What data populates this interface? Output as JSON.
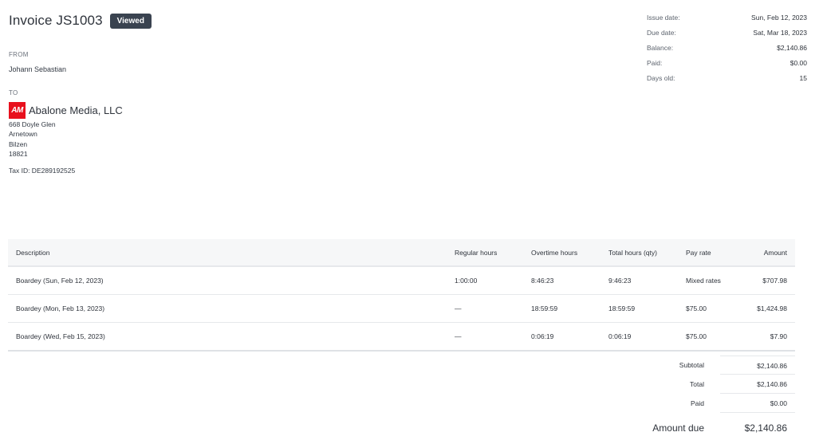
{
  "invoice": {
    "title": "Invoice JS1003",
    "status": "Viewed"
  },
  "from": {
    "label": "FROM",
    "name": "Johann Sebastian"
  },
  "to": {
    "label": "TO",
    "logo_text": "AM",
    "company": "Abalone Media, LLC",
    "address": [
      "668 Doyle Glen",
      "Arnetown",
      "Bilzen",
      "18821"
    ],
    "tax_id": "Tax ID: DE289192525"
  },
  "meta": [
    {
      "key": "Issue date:",
      "value": "Sun, Feb 12, 2023"
    },
    {
      "key": "Due date:",
      "value": "Sat, Mar 18, 2023"
    },
    {
      "key": "Balance:",
      "value": "$2,140.86"
    },
    {
      "key": "Paid:",
      "value": "$0.00"
    },
    {
      "key": "Days old:",
      "value": "15"
    }
  ],
  "table": {
    "headers": [
      "Description",
      "Regular hours",
      "Overtime hours",
      "Total hours (qty)",
      "Pay rate",
      "Amount"
    ],
    "rows": [
      [
        "Boardey (Sun, Feb 12, 2023)",
        "1:00:00",
        "8:46:23",
        "9:46:23",
        "Mixed rates",
        "$707.98"
      ],
      [
        "Boardey (Mon, Feb 13, 2023)",
        "—",
        "18:59:59",
        "18:59:59",
        "$75.00",
        "$1,424.98"
      ],
      [
        "Boardey (Wed, Feb 15, 2023)",
        "—",
        "0:06:19",
        "0:06:19",
        "$75.00",
        "$7.90"
      ]
    ]
  },
  "totals": [
    {
      "key": "Subtotal",
      "value": "$2,140.86"
    },
    {
      "key": "Total",
      "value": "$2,140.86"
    },
    {
      "key": "Paid",
      "value": "$0.00"
    }
  ],
  "amount_due": {
    "key": "Amount due",
    "value": "$2,140.86"
  },
  "colors": {
    "badge": "#3a4350",
    "logo": "#e8101d",
    "header_bg": "#f6f7f8"
  }
}
